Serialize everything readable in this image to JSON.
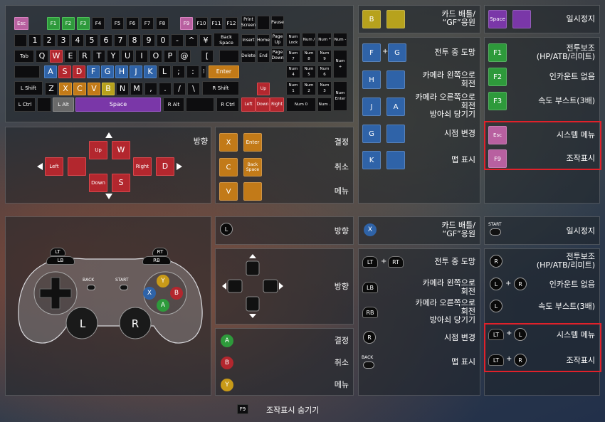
{
  "keyboard": {
    "row1": [
      "Esc",
      "F1",
      "F2",
      "F3",
      "F4",
      "F5",
      "F6",
      "F7",
      "F8",
      "F9",
      "F10",
      "F11",
      "F12",
      "Print Screen",
      "",
      "Pause"
    ],
    "row2": [
      "",
      "1",
      "2",
      "3",
      "4",
      "5",
      "6",
      "7",
      "8",
      "9",
      "0",
      "-",
      "^",
      "¥",
      "Back Space",
      "Insert",
      "Home",
      "Page Up",
      "Num Lock",
      "Num /",
      "Num *",
      "Num -"
    ],
    "row3": [
      "Tab",
      "Q",
      "W",
      "E",
      "R",
      "T",
      "Y",
      "U",
      "I",
      "O",
      "P",
      "@",
      "[",
      "",
      "Delete",
      "End",
      "Page Down",
      "Num 7",
      "Num 8",
      "Num 9",
      "Num +"
    ],
    "row4": [
      "",
      "A",
      "S",
      "D",
      "F",
      "G",
      "H",
      "J",
      "K",
      "L",
      ";",
      ":",
      "]",
      "Enter",
      "Num 4",
      "Num 5",
      "Num 6"
    ],
    "row5": [
      "L Shift",
      "Z",
      "X",
      "C",
      "V",
      "B",
      "N",
      "M",
      ",",
      ".",
      "/",
      "\\",
      "R Shift",
      "Up",
      "Num 1",
      "Num 2",
      "Num 3",
      "Num Enter"
    ],
    "row6": [
      "L Ctrl",
      "",
      "L Alt",
      "Space",
      "R Alt",
      "",
      "R Ctrl",
      "Left",
      "Down",
      "Right",
      "Num 0",
      "Num ."
    ]
  },
  "kb_direction": {
    "label": "방향",
    "keys": {
      "up": "Up",
      "w": "W",
      "left": "Left",
      "right": "Right",
      "d": "D",
      "down": "Down",
      "s": "S",
      "a": ""
    }
  },
  "kb_confirm": [
    {
      "keys": [
        "X",
        "Enter"
      ],
      "label": "결정"
    },
    {
      "keys": [
        "C",
        "Back Space"
      ],
      "label": "취소"
    },
    {
      "keys": [
        "V",
        ""
      ],
      "label": "메뉴"
    }
  ],
  "kb_actions_mid": [
    {
      "keys": [
        "B",
        ""
      ],
      "label": "카드 배틀/\n“GF”응원"
    },
    {
      "keys": [
        "F",
        "G"
      ],
      "plus": "+",
      "label": "전투 중 도망"
    },
    {
      "keys": [
        "H",
        ""
      ],
      "label": "카메라 왼쪽으로\n회전"
    },
    {
      "keys": [
        "J",
        "A"
      ],
      "label": "카메라 오른쪽으로\n회전\n방아쇠 당기기"
    },
    {
      "keys": [
        "G",
        ""
      ],
      "label": "시점 변경"
    },
    {
      "keys": [
        "K",
        ""
      ],
      "label": "맵 표시"
    }
  ],
  "kb_actions_right": [
    {
      "keys": [
        "Space",
        ""
      ],
      "label": "일시정지"
    },
    {
      "keys": [
        "F1"
      ],
      "label": "전투보조\n(HP/ATB/리미트)"
    },
    {
      "keys": [
        "F2"
      ],
      "label": "인카운트 없음"
    },
    {
      "keys": [
        "F3"
      ],
      "label": "속도 부스트(3배)"
    },
    {
      "keys": [
        "Esc"
      ],
      "label": "시스템 메뉴"
    },
    {
      "keys": [
        "F9"
      ],
      "label": "조작표시"
    }
  ],
  "pad_labels": {
    "lt": "LT",
    "lb": "LB",
    "rt": "RT",
    "rb": "RB",
    "back": "BACK",
    "start": "START",
    "y": "Y",
    "x": "X",
    "b": "B",
    "a": "A",
    "l": "L",
    "r": "R"
  },
  "pad_direction": {
    "stick": "L",
    "label": "방향"
  },
  "pad_dpad_label": "방향",
  "pad_confirm": [
    {
      "btn": "A",
      "label": "결정"
    },
    {
      "btn": "B",
      "label": "취소"
    },
    {
      "btn": "Y",
      "label": "메뉴"
    }
  ],
  "pad_actions_mid": [
    {
      "btn": "X",
      "label": "카드 배틀/\n“GF”응원"
    },
    {
      "btn1": "LT",
      "btn2": "RT",
      "plus": "+",
      "label": "전투 중 도망"
    },
    {
      "btn": "LB",
      "label": "카메라 왼쪽으로\n회전"
    },
    {
      "btn": "RB",
      "label": "카메라 오른쪽으로\n회전\n방아쇠 당기기"
    },
    {
      "btn": "R",
      "label": "시점 변경"
    },
    {
      "btn": "BACK",
      "label": "맵 표시"
    }
  ],
  "pad_actions_right": [
    {
      "btn": "START",
      "label": "일시정지"
    },
    {
      "btn": "R",
      "label": "전투보조\n(HP/ATB/리미트)"
    },
    {
      "btn1": "L",
      "btn2": "R",
      "plus": "+",
      "label": "인카운트 없음"
    },
    {
      "btn": "L",
      "label": "속도 부스트(3배)"
    },
    {
      "btn1": "LT",
      "btn2": "L",
      "plus": "+",
      "label": "시스템 메뉴"
    },
    {
      "btn1": "LT",
      "btn2": "R",
      "plus": "+",
      "label": "조작표시"
    }
  ],
  "footer": {
    "key": "F9",
    "label": "조작표시 숨기기"
  },
  "colors": {
    "highlight_box": "#e0212a",
    "wasd": "#b3272e",
    "nav_blue": "#2f63a8",
    "confirm_orange": "#c27a18",
    "space_purple": "#7a37a8",
    "esc_pink": "#b860a0"
  }
}
